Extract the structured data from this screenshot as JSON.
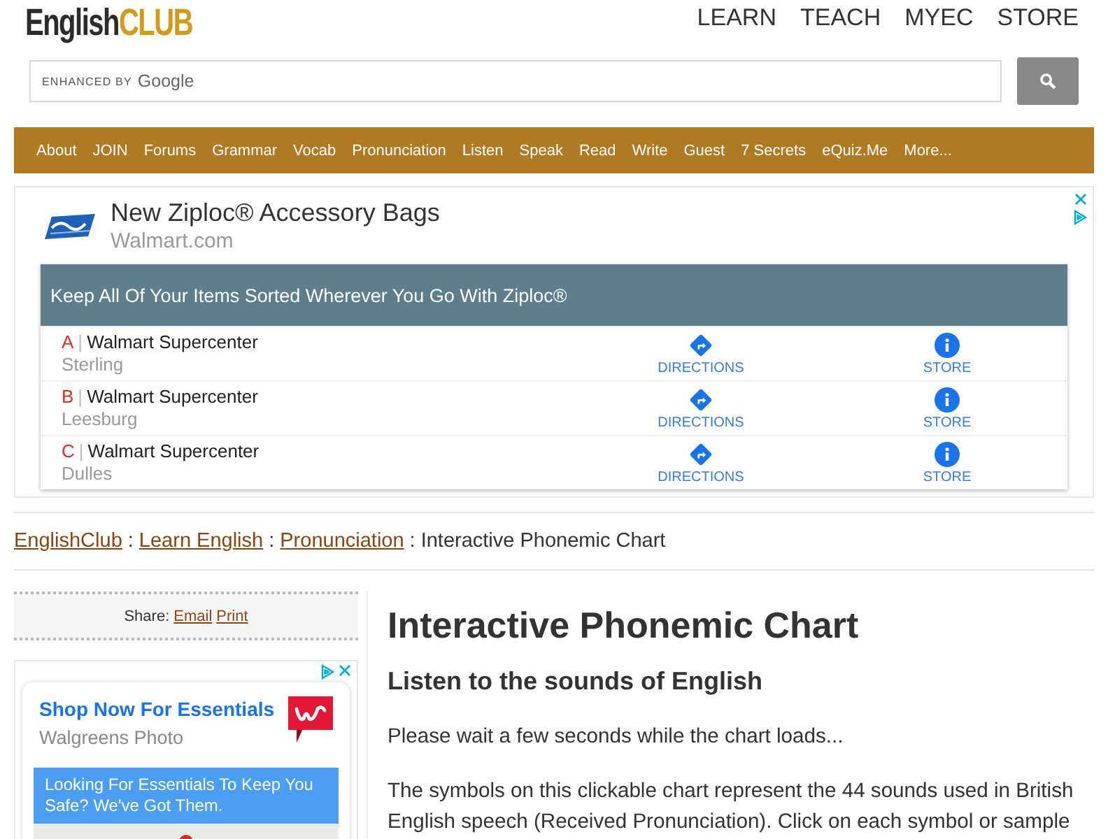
{
  "header": {
    "logo": {
      "text": "English",
      "accent": "CLUB"
    },
    "top_nav": [
      "LEARN",
      "TEACH",
      "MYEC",
      "STORE"
    ]
  },
  "search": {
    "hint_prefix": "ENHANCED BY",
    "hint_brand": "Google"
  },
  "main_nav": [
    "About",
    "JOIN",
    "Forums",
    "Grammar",
    "Vocab",
    "Pronunciation",
    "Listen",
    "Speak",
    "Read",
    "Write",
    "Guest",
    "7 Secrets",
    "eQuiz.Me",
    "More..."
  ],
  "top_ad": {
    "title": "New Ziploc® Accessory Bags",
    "advertiser": "Walmart.com",
    "banner": "Keep All Of Your Items Sorted Wherever You Go With Ziploc®",
    "separator": "|",
    "locations": [
      {
        "letter": "A",
        "name": "Walmart Supercenter",
        "city": "Sterling",
        "directions": "DIRECTIONS",
        "store": "STORE"
      },
      {
        "letter": "B",
        "name": "Walmart Supercenter",
        "city": "Leesburg",
        "directions": "DIRECTIONS",
        "store": "STORE"
      },
      {
        "letter": "C",
        "name": "Walmart Supercenter",
        "city": "Dulles",
        "directions": "DIRECTIONS",
        "store": "STORE"
      }
    ]
  },
  "breadcrumb": {
    "separator": ":",
    "items": [
      {
        "label": "EnglishClub",
        "kind": "link"
      },
      {
        "label": "Learn English",
        "kind": "link"
      },
      {
        "label": "Pronunciation",
        "kind": "link"
      },
      {
        "label": "Interactive Phonemic Chart",
        "kind": "current"
      }
    ]
  },
  "share": {
    "label": "Share:",
    "links": [
      "Email",
      "Print"
    ]
  },
  "side_ad": {
    "title": "Shop Now For Essentials",
    "advertiser": "Walgreens Photo",
    "message": "Looking For Essentials To Keep You Safe? We've Got Them."
  },
  "article": {
    "title": "Interactive Phonemic Chart",
    "subtitle": "Listen to the sounds of English",
    "paragraphs": [
      "Please wait a few seconds while the chart loads...",
      "The symbols on this clickable chart represent the 44 sounds used in British English speech (Received Pronunciation). Click on each symbol or sample"
    ]
  }
}
